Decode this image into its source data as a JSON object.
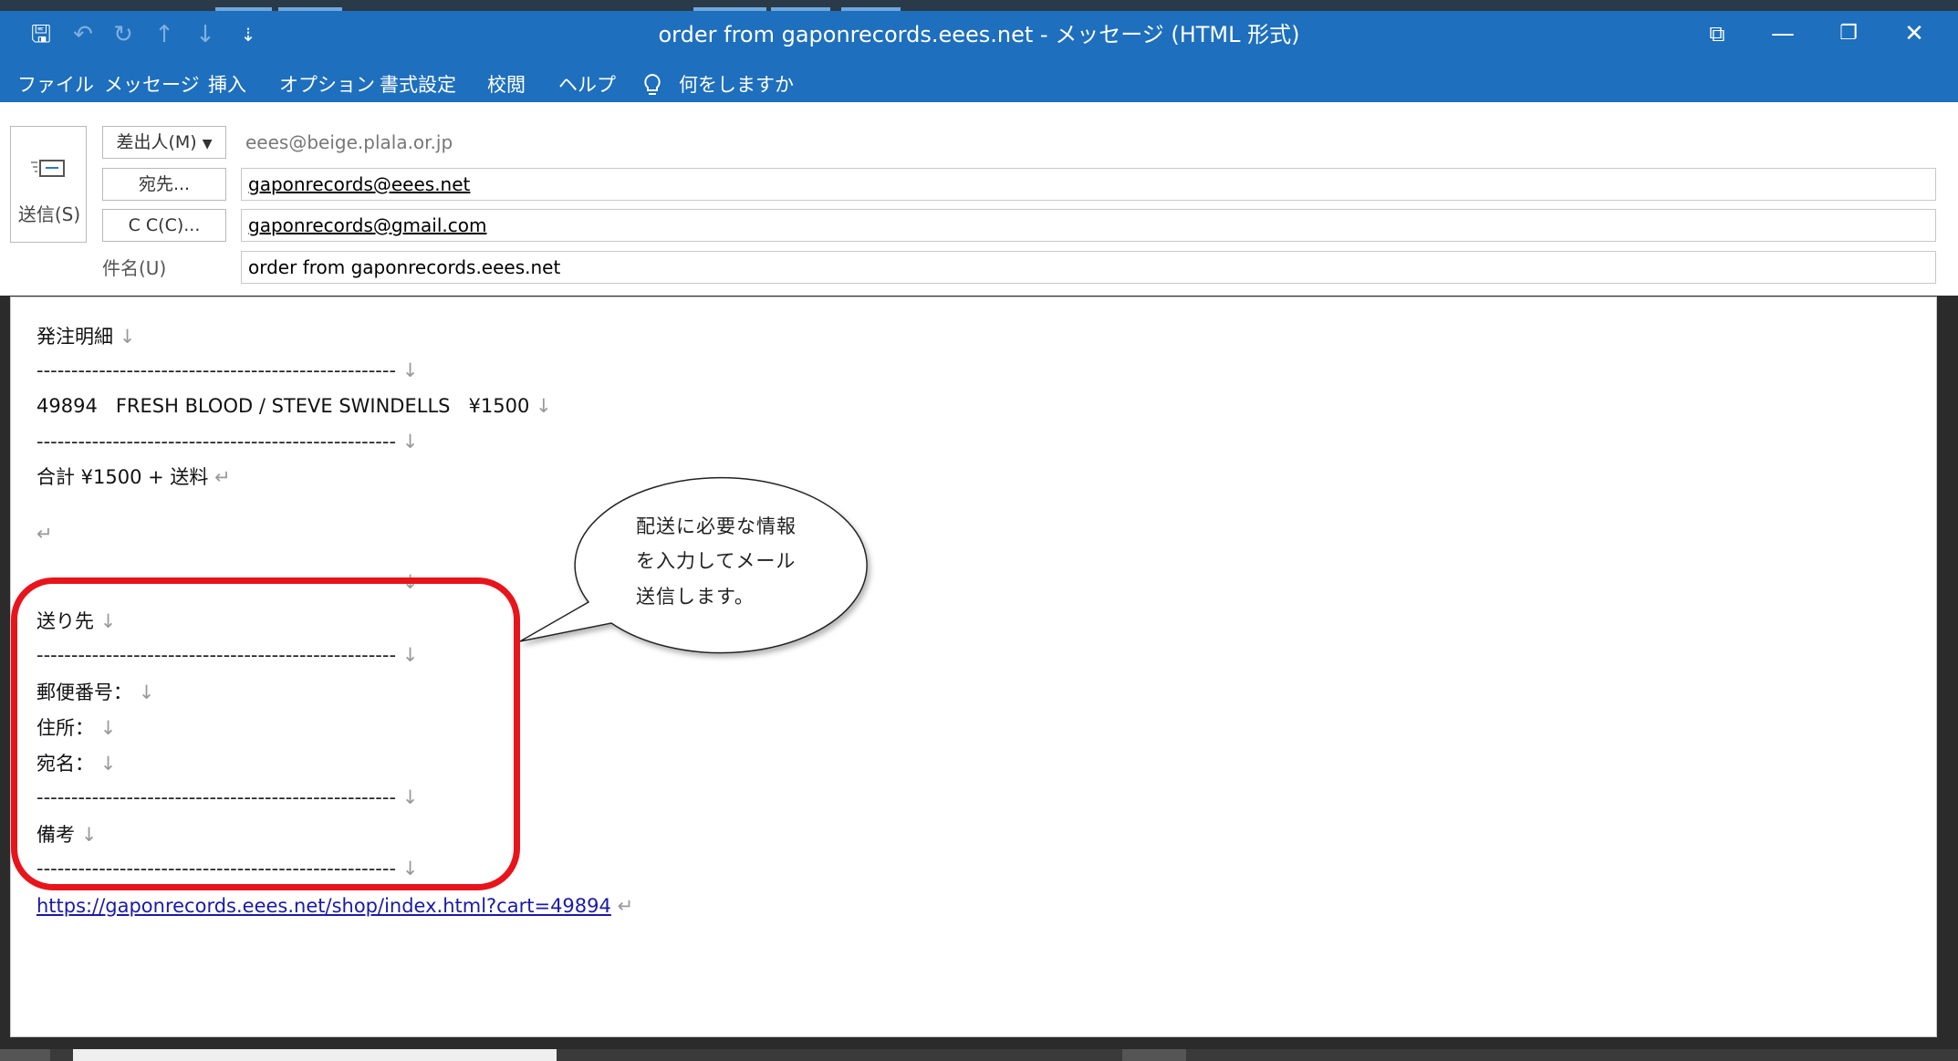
{
  "window": {
    "title": "order from gaponrecords.eees.net  -  メッセージ (HTML 形式)",
    "quick_access": [
      {
        "icon": "save-icon",
        "glyph": "🖫"
      },
      {
        "icon": "undo-icon",
        "glyph": "↶"
      },
      {
        "icon": "redo-icon",
        "glyph": "↻"
      },
      {
        "icon": "up-arrow-icon",
        "glyph": "↑"
      },
      {
        "icon": "down-arrow-icon",
        "glyph": "↓"
      },
      {
        "icon": "customize-toolbar-icon",
        "glyph": "⇣"
      }
    ],
    "controls": {
      "ribbon_display": "⧉",
      "minimize": "—",
      "restore": "❐",
      "close": "✕"
    }
  },
  "ribbon": {
    "tabs": [
      "ファイル",
      "メッセージ",
      "挿入",
      "オプション",
      "書式設定",
      "校閲",
      "ヘルプ"
    ],
    "tell_me": "何をしますか"
  },
  "header": {
    "send_label": "送信(S)",
    "from_button": "差出人(M)",
    "from_address": "eees@beige.plala.or.jp",
    "to_button": "宛先...",
    "to_value": "gaponrecords@eees.net",
    "cc_button": "C C(C)...",
    "cc_value": "gaponrecords@gmail.com",
    "subject_label": "件名(U)",
    "subject_value": "order from gaponrecords.eees.net"
  },
  "body": {
    "line_break_mark": "↓",
    "paragraph_mark": "↵",
    "lines": {
      "order_title": "発注明細",
      "separator": "----------------------------------------------------",
      "item": "49894   FRESH BLOOD / STEVE SWINDELLS   ¥1500",
      "total": "合計 ¥1500 + 送料",
      "ship_to": "送り先",
      "postal_code": "郵便番号：",
      "address": "住所：",
      "recipient": "宛名：",
      "notes": "備考",
      "url": "https://gaponrecords.eees.net/shop/index.html?cart=49894"
    }
  },
  "annotation": {
    "lines": [
      "配送に必要な情報",
      "を入力してメール",
      "送信します。"
    ],
    "highlight_color": "#e8141b"
  },
  "colors": {
    "accent": "#1e6fbd",
    "link": "#1a1aa8"
  }
}
